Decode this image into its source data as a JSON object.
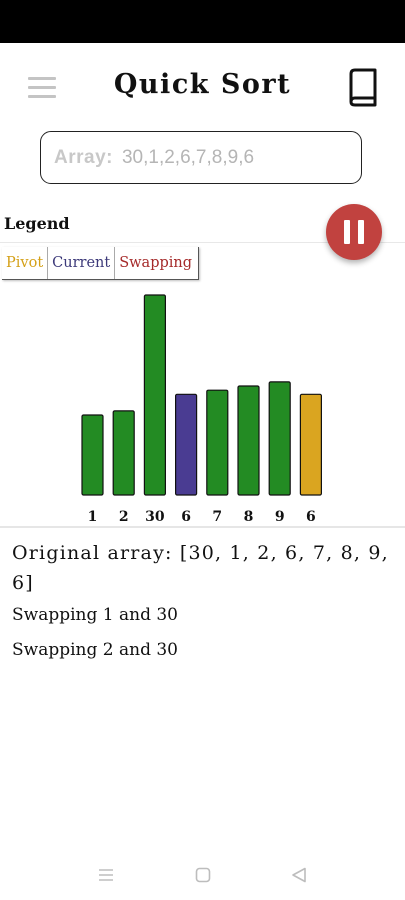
{
  "app": {
    "title": "Quick Sort"
  },
  "input": {
    "label": "Array:",
    "value": "30,1,2,6,7,8,9,6"
  },
  "legend": {
    "title": "Legend",
    "items": [
      {
        "label": "Pivot",
        "color": "#d4a017"
      },
      {
        "label": "Current",
        "color": "#3d3a7a"
      },
      {
        "label": "Swapping",
        "color": "#a52a2a"
      }
    ]
  },
  "colors": {
    "default_bar": "#238b23",
    "current_bar": "#4a3c92",
    "pivot_bar": "#daa520",
    "pause_button": "#c1423f"
  },
  "chart_data": {
    "type": "bar",
    "categories": [
      "1",
      "2",
      "30",
      "6",
      "7",
      "8",
      "9",
      "6"
    ],
    "values": [
      1,
      2,
      30,
      6,
      7,
      8,
      9,
      6
    ],
    "states": [
      "default",
      "default",
      "default",
      "current",
      "default",
      "default",
      "default",
      "pivot"
    ]
  },
  "log": {
    "original": "Original array: [30, 1, 2, 6, 7, 8, 9, 6]",
    "steps": [
      "Swapping 1 and 30",
      "Swapping 2 and 30"
    ]
  },
  "icons": {
    "menu": "hamburger-menu-icon",
    "book": "book-icon",
    "pause": "pause-icon",
    "nav_recents": "recents-icon",
    "nav_home": "home-icon",
    "nav_back": "back-icon"
  }
}
